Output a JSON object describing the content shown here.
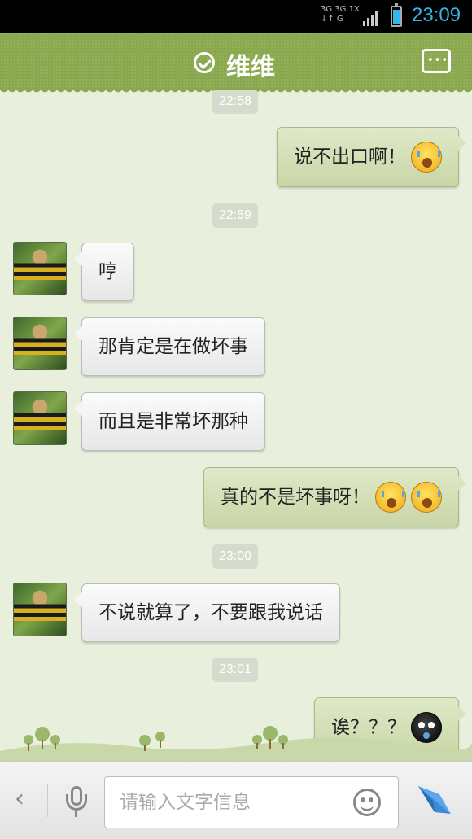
{
  "status_bar": {
    "network_top": "3G 3G 1X",
    "network_bottom": "↓↑ G",
    "time": "23:09",
    "accent_color": "#33b5e5"
  },
  "header": {
    "title": "维维",
    "status_icon": "check-circle-icon",
    "menu_icon": "more-dots-icon",
    "color": "#8aa94e"
  },
  "messages": [
    {
      "type": "timestamp",
      "text": "22:58"
    },
    {
      "type": "sent",
      "text": "说不出口啊！",
      "emojis": [
        "crying-emoji"
      ]
    },
    {
      "type": "timestamp",
      "text": "22:59"
    },
    {
      "type": "received",
      "text": "哼"
    },
    {
      "type": "received",
      "text": "那肯定是在做坏事"
    },
    {
      "type": "received",
      "text": "而且是非常坏那种"
    },
    {
      "type": "sent",
      "text": "真的不是坏事呀！",
      "emojis": [
        "crying-emoji",
        "crying-emoji"
      ]
    },
    {
      "type": "timestamp",
      "text": "23:00"
    },
    {
      "type": "received",
      "text": "不说就算了，不要跟我说话"
    },
    {
      "type": "timestamp",
      "text": "23:01"
    },
    {
      "type": "sent",
      "text": "诶？？？",
      "emojis": [
        "bomb-emoji"
      ]
    }
  ],
  "input_bar": {
    "placeholder": "请输入文字信息",
    "back_icon": "chevron-left-icon",
    "voice_icon": "microphone-icon",
    "emoji_icon": "smiley-icon",
    "send_icon": "send-arrow-icon",
    "send_color": "#3a8ad6"
  }
}
